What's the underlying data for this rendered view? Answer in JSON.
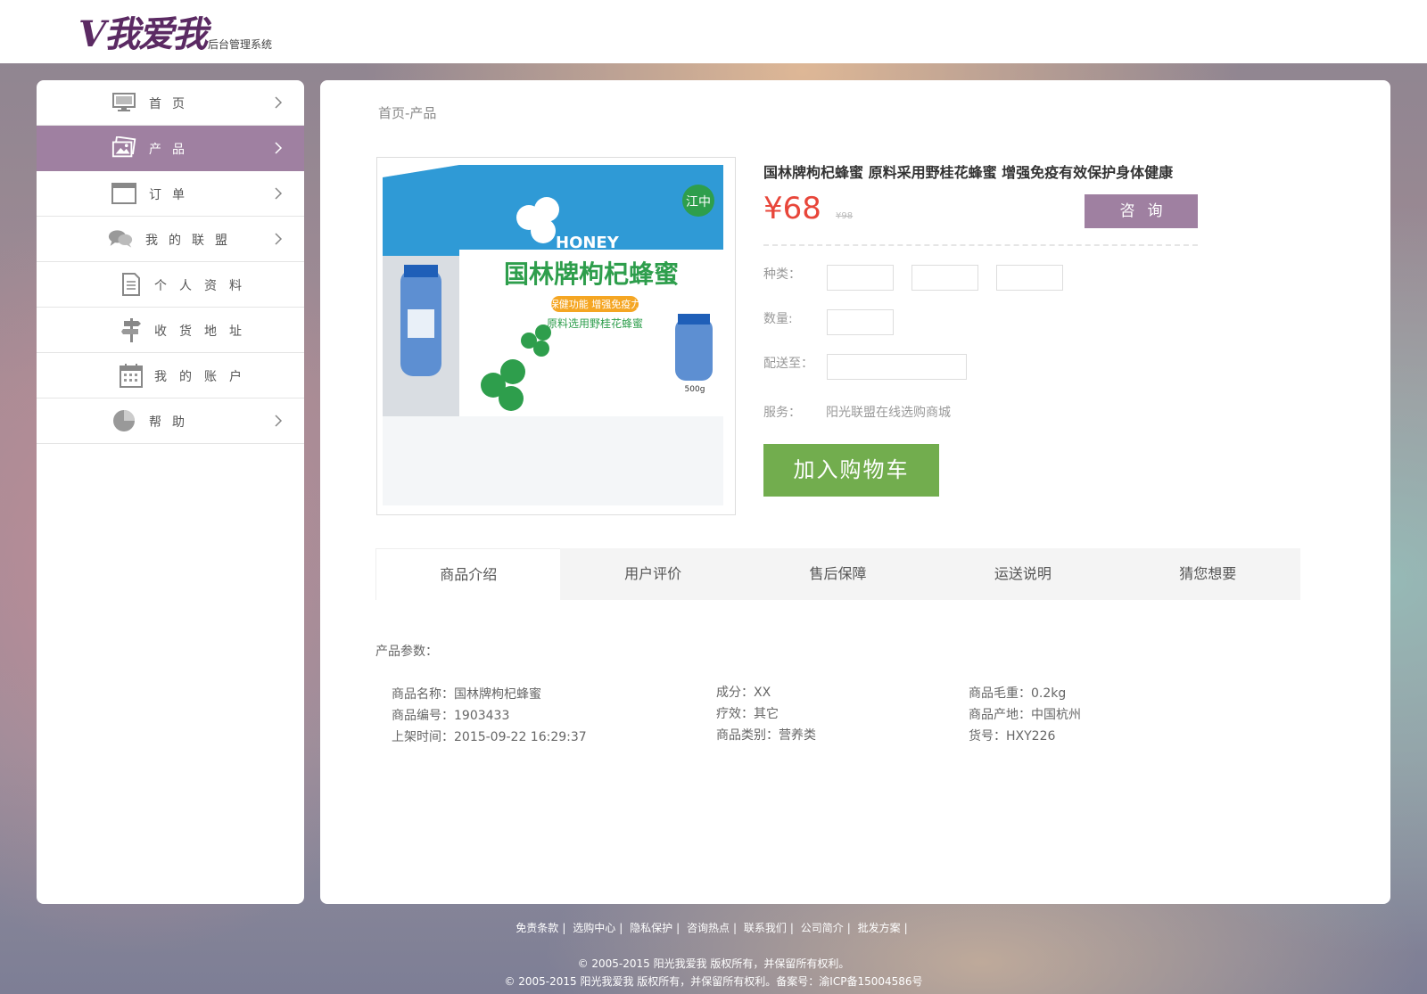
{
  "header": {
    "logo_text": "V我爱我",
    "subtitle": "后台管理系统"
  },
  "sidebar": {
    "items": [
      {
        "label": "首页",
        "icon": "monitor-icon",
        "active": false
      },
      {
        "label": "产品",
        "icon": "image-icon",
        "active": true
      },
      {
        "label": "订单",
        "icon": "window-icon",
        "active": false
      },
      {
        "label": "我的联盟",
        "icon": "chat-icon",
        "active": false
      },
      {
        "label": "个人资料",
        "icon": "document-icon",
        "active": false
      },
      {
        "label": "收货地址",
        "icon": "signpost-icon",
        "active": false
      },
      {
        "label": "我的账户",
        "icon": "calendar-icon",
        "active": false
      },
      {
        "label": "帮助",
        "icon": "pie-chart-icon",
        "active": false
      }
    ]
  },
  "breadcrumb": "首页-产品",
  "product": {
    "title": "国林牌枸杞蜂蜜 原料采用野桂花蜂蜜 增强免疫有效保护身体健康",
    "price": "¥68",
    "old_price": "¥98",
    "consult_label": "咨询",
    "image_texts": {
      "brand_en": "HONEY",
      "name": "国林牌枸杞蜂蜜",
      "tag": "保健功能 增强免疫力",
      "material": "原料选用野桂花蜂蜜",
      "badge": "江中",
      "weight": "500g"
    },
    "fields": {
      "kind_label": "种类：",
      "qty_label": "数量:",
      "ship_label": "配送至：",
      "service_label": "服务：",
      "service_value": "阳光联盟在线选购商城"
    },
    "add_to_cart": "加入购物车"
  },
  "tabs": [
    "商品介绍",
    "用户评价",
    "售后保障",
    "运送说明",
    "猜您想要"
  ],
  "params": {
    "label": "产品参数：",
    "col1": [
      "商品名称：国林牌枸杞蜂蜜",
      "商品编号：1903433",
      "上架时间：2015-09-22 16:29:37"
    ],
    "col2": [
      "成分：XX",
      "疗效：其它",
      "商品类别：营养类"
    ],
    "col3": [
      "商品毛重：0.2kg",
      "商品产地：中国杭州",
      "货号：HXY226"
    ]
  },
  "footer": {
    "links": [
      "免责条款",
      "选购中心",
      "隐私保护",
      "咨询热点",
      "联系我们",
      "公司简介",
      "批发方案"
    ],
    "copy1": "© 2005-2015 阳光我爱我 版权所有，并保留所有权利。",
    "copy2": "© 2005-2015 阳光我爱我 版权所有，并保留所有权利。备案号：渝ICP备15004586号"
  },
  "colors": {
    "accent": "#9f80a1",
    "price": "#e8463a",
    "cart": "#72ad4e",
    "logo": "#5b2a63"
  }
}
